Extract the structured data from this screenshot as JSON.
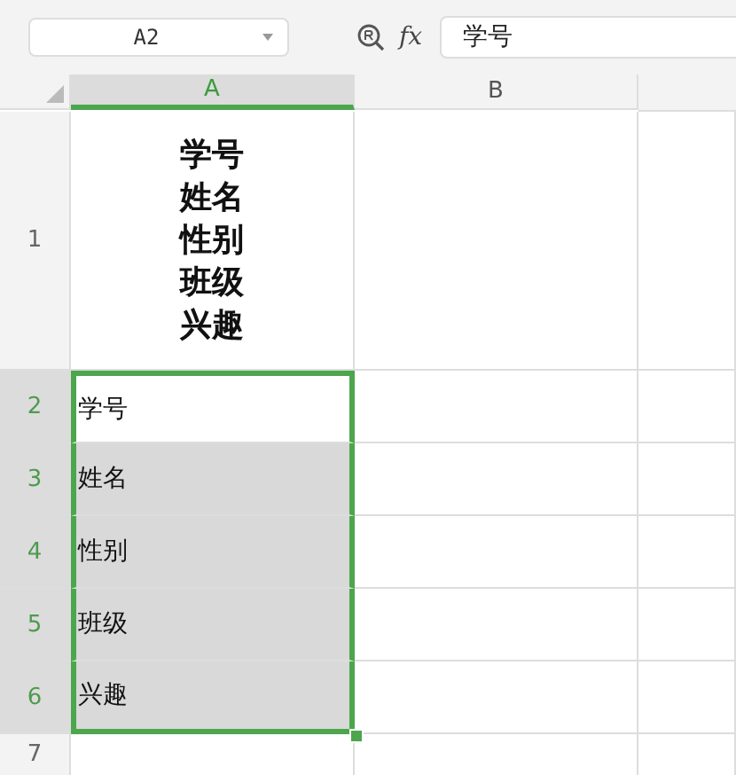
{
  "name_box": {
    "value": "A2"
  },
  "formula_bar": {
    "fx_label": "fx",
    "value": "学号"
  },
  "columns": [
    {
      "label": "A",
      "selected": true
    },
    {
      "label": "B",
      "selected": false
    }
  ],
  "rows": [
    {
      "label": "1",
      "selected": false,
      "cells": [
        {
          "lines": [
            "学号",
            "姓名",
            "性别",
            "班级",
            "兴趣"
          ],
          "bold": true,
          "selected": false,
          "active": false
        }
      ]
    },
    {
      "label": "2",
      "selected": true,
      "cells": [
        {
          "text": "学号",
          "bold": false,
          "selected": true,
          "active": true
        }
      ]
    },
    {
      "label": "3",
      "selected": true,
      "cells": [
        {
          "text": "姓名",
          "bold": false,
          "selected": true,
          "active": false
        }
      ]
    },
    {
      "label": "4",
      "selected": true,
      "cells": [
        {
          "text": "性别",
          "bold": false,
          "selected": true,
          "active": false
        }
      ]
    },
    {
      "label": "5",
      "selected": true,
      "cells": [
        {
          "text": "班级",
          "bold": false,
          "selected": true,
          "active": false
        }
      ]
    },
    {
      "label": "6",
      "selected": true,
      "cells": [
        {
          "text": "兴趣",
          "bold": false,
          "selected": true,
          "active": false
        }
      ]
    },
    {
      "label": "7",
      "selected": false,
      "cells": []
    }
  ]
}
